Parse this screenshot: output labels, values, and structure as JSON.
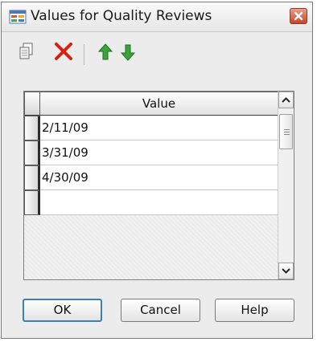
{
  "window": {
    "title": "Values for Quality Reviews"
  },
  "icons": {
    "app": "dialog-app-icon",
    "close": "close-icon",
    "copy": "copy-icon",
    "delete": "delete-icon",
    "move_up": "arrow-up-icon",
    "move_down": "arrow-down-icon",
    "scroll_up": "chevron-up-icon",
    "scroll_down": "chevron-down-icon"
  },
  "colors": {
    "delete": "#d91f10",
    "arrows": "#3aa33a",
    "close": "#c8452b",
    "default_button_border": "#3c7fb1"
  },
  "grid": {
    "column_header": "Value",
    "rows": [
      "2/11/09",
      "3/31/09",
      "4/30/09",
      ""
    ]
  },
  "buttons": {
    "ok": "OK",
    "cancel": "Cancel",
    "help": "Help"
  }
}
